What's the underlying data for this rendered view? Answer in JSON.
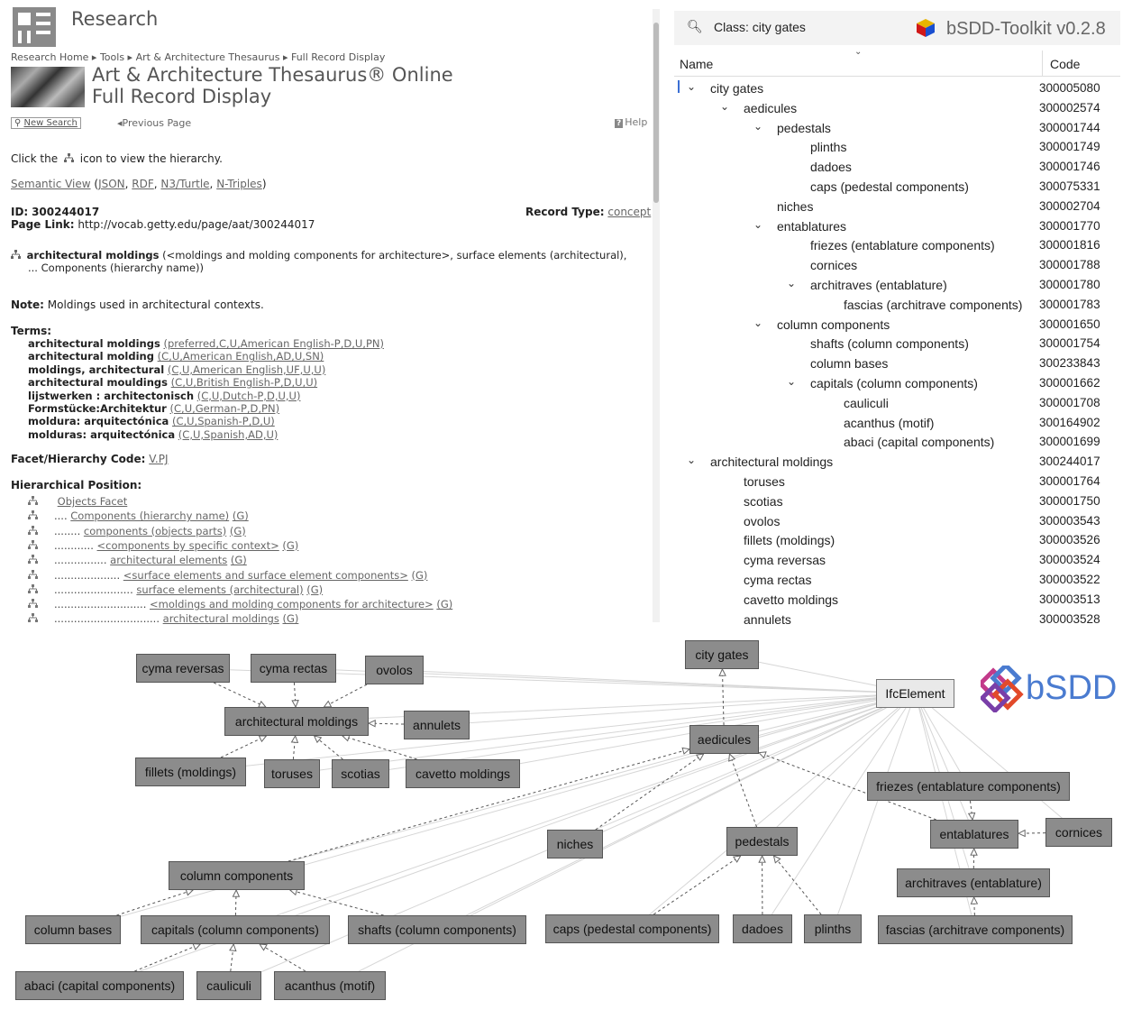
{
  "getty": {
    "brand": "Research",
    "breadcrumb": "Research Home ▸ Tools ▸ Art & Architecture Thesaurus ▸ Full Record Display",
    "title_line1": "Art & Architecture Thesaurus® Online",
    "title_line2": "Full Record Display",
    "new_search": "New Search",
    "previous_page": "◂Previous Page",
    "help": "Help",
    "hint_pre": "Click the",
    "hint_post": "icon to view the hierarchy.",
    "semantic_view": "Semantic View",
    "formats": [
      "JSON",
      "RDF",
      "N3/Turtle",
      "N-Triples"
    ],
    "id_label": "ID:",
    "id_value": "300244017",
    "page_link_label": "Page Link:",
    "page_link": "http://vocab.getty.edu/page/aat/300244017",
    "record_type_label": "Record Type:",
    "record_type": "concept",
    "heading_term": "architectural moldings",
    "heading_rest": "(<moldings and molding components for architecture>, surface elements (architectural),",
    "heading_rest2": "... Components (hierarchy name))",
    "note_label": "Note:",
    "note": "Moldings used in architectural contexts.",
    "terms_label": "Terms:",
    "terms": [
      {
        "term": "architectural moldings",
        "q": "(preferred,C,U,American English-P,D,U,PN)"
      },
      {
        "term": "architectural molding",
        "q": "(C,U,American English,AD,U,SN)"
      },
      {
        "term": "moldings, architectural",
        "q": "(C,U,American English,UF,U,U)"
      },
      {
        "term": "architectural mouldings",
        "q": "(C,U,British English-P,D,U,U)"
      },
      {
        "term": "lijstwerken : architectonisch",
        "q": "(C,U,Dutch-P,D,U,U)"
      },
      {
        "term": "Formstücke:Architektur",
        "q": "(C,U,German-P,D,PN)"
      },
      {
        "term": "moldura: arquitectónica",
        "q": "(C,U,Spanish-P,D,U)"
      },
      {
        "term": "molduras: arquitectónica",
        "q": "(C,U,Spanish,AD,U)"
      }
    ],
    "facet_label": "Facet/Hierarchy Code:",
    "facet": "V.PJ",
    "hier_label": "Hierarchical Position:",
    "hierarchy": [
      {
        "dots": "",
        "label": "Objects Facet",
        "g": ""
      },
      {
        "dots": "....",
        "label": "Components (hierarchy name)",
        "g": "(G)"
      },
      {
        "dots": "........",
        "label": "components (objects parts)",
        "g": "(G)"
      },
      {
        "dots": "............",
        "label": "<components by specific context>",
        "g": "(G)"
      },
      {
        "dots": "................",
        "label": "architectural elements",
        "g": "(G)"
      },
      {
        "dots": "....................",
        "label": "<surface elements and surface element components>",
        "g": "(G)"
      },
      {
        "dots": "........................",
        "label": "surface elements (architectural)",
        "g": "(G)"
      },
      {
        "dots": "............................",
        "label": "<moldings and molding components for architecture>",
        "g": "(G)"
      },
      {
        "dots": "................................",
        "label": "architectural moldings",
        "g": "(G)"
      }
    ]
  },
  "bsdd_tree": {
    "class_label": "Class:",
    "class_value": "city gates",
    "toolkit": "bSDD-Toolkit v0.2.8",
    "col_name": "Name",
    "col_code": "Code",
    "rows": [
      {
        "name": "city gates",
        "code": "300005080",
        "level": 0,
        "expanded": true
      },
      {
        "name": "aedicules",
        "code": "300002574",
        "level": 1,
        "expanded": true
      },
      {
        "name": "pedestals",
        "code": "300001744",
        "level": 2,
        "expanded": true
      },
      {
        "name": "plinths",
        "code": "300001749",
        "level": 3,
        "expanded": false
      },
      {
        "name": "dadoes",
        "code": "300001746",
        "level": 3,
        "expanded": false
      },
      {
        "name": "caps (pedestal components)",
        "code": "300075331",
        "level": 3,
        "expanded": false
      },
      {
        "name": "niches",
        "code": "300002704",
        "level": 2,
        "expanded": false
      },
      {
        "name": "entablatures",
        "code": "300001770",
        "level": 2,
        "expanded": true
      },
      {
        "name": "friezes (entablature components)",
        "code": "300001816",
        "level": 3,
        "expanded": false
      },
      {
        "name": "cornices",
        "code": "300001788",
        "level": 3,
        "expanded": false
      },
      {
        "name": "architraves (entablature)",
        "code": "300001780",
        "level": 3,
        "expanded": true
      },
      {
        "name": "fascias (architrave components)",
        "code": "300001783",
        "level": 4,
        "expanded": false
      },
      {
        "name": "column components",
        "code": "300001650",
        "level": 2,
        "expanded": true
      },
      {
        "name": "shafts (column components)",
        "code": "300001754",
        "level": 3,
        "expanded": false
      },
      {
        "name": "column bases",
        "code": "300233843",
        "level": 3,
        "expanded": false
      },
      {
        "name": "capitals (column components)",
        "code": "300001662",
        "level": 3,
        "expanded": true
      },
      {
        "name": "cauliculi",
        "code": "300001708",
        "level": 4,
        "expanded": false
      },
      {
        "name": "acanthus (motif)",
        "code": "300164902",
        "level": 4,
        "expanded": false
      },
      {
        "name": "abaci (capital components)",
        "code": "300001699",
        "level": 4,
        "expanded": false
      },
      {
        "name": "architectural moldings",
        "code": "300244017",
        "level": 0,
        "expanded": true
      },
      {
        "name": "toruses",
        "code": "300001764",
        "level": 1,
        "expanded": false
      },
      {
        "name": "scotias",
        "code": "300001750",
        "level": 1,
        "expanded": false
      },
      {
        "name": "ovolos",
        "code": "300003543",
        "level": 1,
        "expanded": false
      },
      {
        "name": "fillets (moldings)",
        "code": "300003526",
        "level": 1,
        "expanded": false
      },
      {
        "name": "cyma reversas",
        "code": "300003524",
        "level": 1,
        "expanded": false
      },
      {
        "name": "cyma rectas",
        "code": "300003522",
        "level": 1,
        "expanded": false
      },
      {
        "name": "cavetto moldings",
        "code": "300003513",
        "level": 1,
        "expanded": false
      },
      {
        "name": "annulets",
        "code": "300003528",
        "level": 1,
        "expanded": false
      }
    ]
  },
  "diagram": {
    "root": "IfcElement",
    "logo_text": "bSDD",
    "logo_color": "#4a7bd0",
    "nodes": [
      {
        "id": "cyma_reversas",
        "label": "cyma reversas"
      },
      {
        "id": "cyma_rectas",
        "label": "cyma rectas"
      },
      {
        "id": "ovolos",
        "label": "ovolos"
      },
      {
        "id": "arch_moldings",
        "label": "architectural moldings"
      },
      {
        "id": "annulets",
        "label": "annulets"
      },
      {
        "id": "fillets",
        "label": "fillets (moldings)"
      },
      {
        "id": "toruses",
        "label": "toruses"
      },
      {
        "id": "scotias",
        "label": "scotias"
      },
      {
        "id": "cavetto",
        "label": "cavetto moldings"
      },
      {
        "id": "city_gates",
        "label": "city gates"
      },
      {
        "id": "ifc",
        "label": "IfcElement"
      },
      {
        "id": "aedicules",
        "label": "aedicules"
      },
      {
        "id": "friezes",
        "label": "friezes (entablature components)"
      },
      {
        "id": "niches",
        "label": "niches"
      },
      {
        "id": "pedestals",
        "label": "pedestals"
      },
      {
        "id": "entablatures",
        "label": "entablatures"
      },
      {
        "id": "cornices",
        "label": "cornices"
      },
      {
        "id": "column_components",
        "label": "column components"
      },
      {
        "id": "architraves",
        "label": "architraves (entablature)"
      },
      {
        "id": "column_bases",
        "label": "column bases"
      },
      {
        "id": "capitals",
        "label": "capitals (column components)"
      },
      {
        "id": "shafts",
        "label": "shafts (column components)"
      },
      {
        "id": "caps",
        "label": "caps (pedestal components)"
      },
      {
        "id": "dadoes",
        "label": "dadoes"
      },
      {
        "id": "plinths",
        "label": "plinths"
      },
      {
        "id": "fascias",
        "label": "fascias (architrave components)"
      },
      {
        "id": "abaci",
        "label": "abaci (capital components)"
      },
      {
        "id": "cauliculi",
        "label": "cauliculi"
      },
      {
        "id": "acanthus",
        "label": "acanthus (motif)"
      }
    ]
  }
}
